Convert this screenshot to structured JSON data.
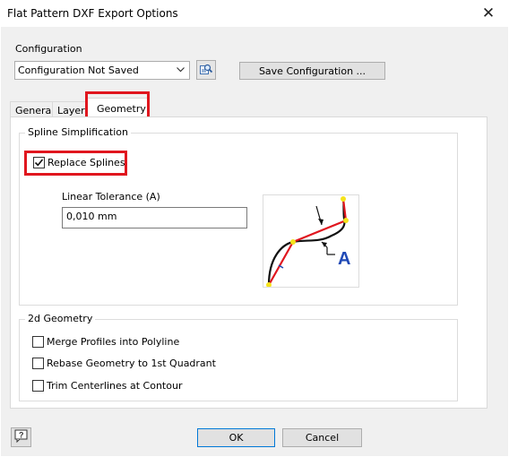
{
  "window": {
    "title": "Flat Pattern DXF Export Options",
    "close_glyph": "✕"
  },
  "configuration": {
    "label": "Configuration",
    "selected": "Configuration Not Saved",
    "load_icon": "load-configuration-icon",
    "save_button": "Save Configuration ..."
  },
  "tabs": [
    {
      "label": "General",
      "active": false
    },
    {
      "label": "Layer",
      "active": false
    },
    {
      "label": "Geometry",
      "active": true
    }
  ],
  "spline": {
    "group_title": "Spline Simplification",
    "replace_splines": {
      "label": "Replace Splines",
      "checked": true
    },
    "tolerance_label": "Linear Tolerance (A)",
    "tolerance_value": "0,010 mm",
    "diagram_letter": "A"
  },
  "geometry2d": {
    "group_title": "2d Geometry",
    "options": [
      {
        "label": "Merge Profiles into Polyline",
        "checked": false
      },
      {
        "label": "Rebase Geometry to 1st Quadrant",
        "checked": false
      },
      {
        "label": "Trim Centerlines at Contour",
        "checked": false
      }
    ]
  },
  "footer": {
    "help_icon": "help-icon",
    "ok": "OK",
    "cancel": "Cancel"
  },
  "colors": {
    "highlight": "#e0161e",
    "diagram_letter": "#1f49b6",
    "diagram_segment": "#e0161e",
    "diagram_point": "#f5e31b"
  }
}
